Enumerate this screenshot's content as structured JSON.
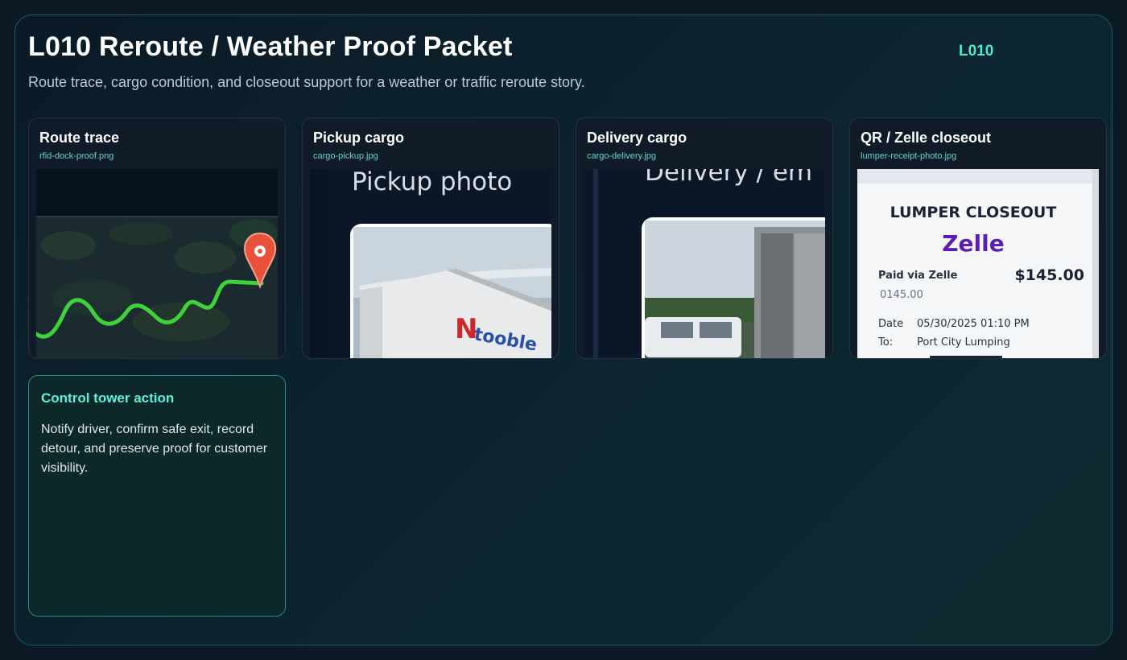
{
  "header": {
    "title": "L010 Reroute / Weather Proof Packet",
    "badge": "L010",
    "subtitle": "Route trace, cargo condition, and closeout support for a weather or traffic reroute story."
  },
  "cards": [
    {
      "title": "Route trace",
      "file": "rfid-dock-proof.png",
      "image": "map-route-trace-icon"
    },
    {
      "title": "Pickup cargo",
      "file": "cargo-pickup.jpg",
      "image_caption": "Pickup photo",
      "truck_logo": "N",
      "truck_text": "tooble"
    },
    {
      "title": "Delivery cargo",
      "file": "cargo-delivery.jpg",
      "image_caption": "Delivery / em"
    },
    {
      "title": "QR / Zelle closeout",
      "file": "lumper-receipt-photo.jpg",
      "receipt": {
        "heading": "LUMPER CLOSEOUT",
        "brand": "Zelle",
        "paid_label": "Paid via Zelle",
        "amount": "$145.00",
        "amount_small": "0145.00",
        "date_label": "Date",
        "date_value": "05/30/2025 01:10 PM",
        "to_label": "To:",
        "to_value": "Port City Lumping"
      }
    }
  ],
  "action": {
    "title": "Control tower action",
    "body": "Notify driver, confirm safe exit, record detour, and preserve proof for customer visibility."
  },
  "colors": {
    "accent": "#4fe8d0",
    "route_line": "#3ed13a",
    "pin": "#e8523a",
    "zelle": "#5a1fb0"
  }
}
